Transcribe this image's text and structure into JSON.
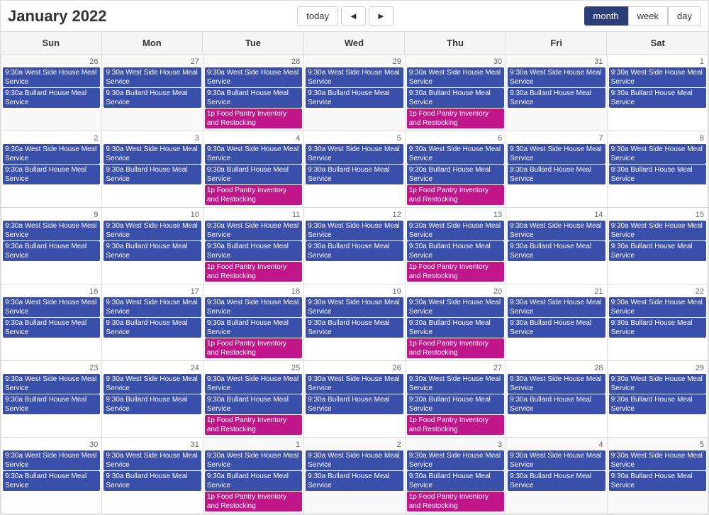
{
  "header": {
    "title": "January 2022",
    "today_label": "today",
    "prev_label": "◄",
    "next_label": "►",
    "view_month": "month",
    "view_week": "week",
    "view_day": "day"
  },
  "day_headers": [
    "Sun",
    "Mon",
    "Tue",
    "Wed",
    "Thu",
    "Fri",
    "Sat"
  ],
  "events": {
    "west_side": "9:30a West Side House Meal Service",
    "bullard": "9:30a Bullard House Meal Service",
    "food_pantry": "1p Food Pantry Inventory and Restocking"
  },
  "weeks": [
    {
      "days": [
        {
          "date": "26",
          "other": true
        },
        {
          "date": "27",
          "other": true
        },
        {
          "date": "28",
          "other": true
        },
        {
          "date": "29",
          "other": true
        },
        {
          "date": "30",
          "other": true
        },
        {
          "date": "31",
          "other": true
        },
        {
          "date": "1",
          "other": false
        }
      ]
    },
    {
      "days": [
        {
          "date": "2"
        },
        {
          "date": "3"
        },
        {
          "date": "4"
        },
        {
          "date": "5"
        },
        {
          "date": "6"
        },
        {
          "date": "7"
        },
        {
          "date": "8"
        }
      ]
    },
    {
      "days": [
        {
          "date": "9"
        },
        {
          "date": "10"
        },
        {
          "date": "11"
        },
        {
          "date": "12"
        },
        {
          "date": "13"
        },
        {
          "date": "14"
        },
        {
          "date": "15"
        }
      ]
    },
    {
      "days": [
        {
          "date": "16"
        },
        {
          "date": "17"
        },
        {
          "date": "18"
        },
        {
          "date": "19"
        },
        {
          "date": "20"
        },
        {
          "date": "21"
        },
        {
          "date": "22"
        }
      ]
    },
    {
      "days": [
        {
          "date": "23"
        },
        {
          "date": "24"
        },
        {
          "date": "25"
        },
        {
          "date": "26"
        },
        {
          "date": "27"
        },
        {
          "date": "28"
        },
        {
          "date": "29"
        }
      ]
    },
    {
      "days": [
        {
          "date": "30"
        },
        {
          "date": "31"
        },
        {
          "date": "1",
          "other": true
        },
        {
          "date": "2",
          "other": true
        },
        {
          "date": "3",
          "other": true
        },
        {
          "date": "4",
          "other": true
        },
        {
          "date": "5",
          "other": true
        }
      ]
    }
  ]
}
